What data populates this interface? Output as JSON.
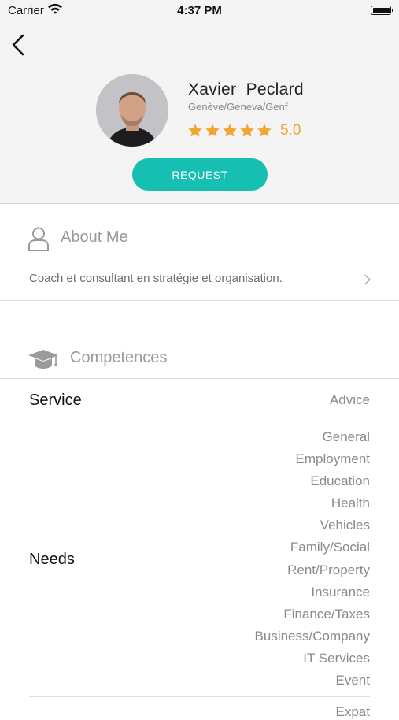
{
  "status_bar": {
    "carrier": "Carrier",
    "time": "4:37 PM"
  },
  "profile": {
    "name": "Xavier  Peclard",
    "location": "Genève/Geneva/Genf",
    "rating_value": "5.0",
    "rating": 5,
    "stars_max": 5,
    "request_label": "REQUEST"
  },
  "about": {
    "title": "About Me",
    "text": "Coach et consultant en stratégie et organisation."
  },
  "competences": {
    "title": "Competences",
    "service_label": "Service",
    "service_value": "Advice",
    "needs_label": "Needs",
    "needs": [
      "General",
      "Employment",
      "Education",
      "Health",
      "Vehicles",
      "Family/Social",
      "Rent/Property",
      "Insurance",
      "Finance/Taxes",
      "Business/Company",
      "IT Services",
      "Event"
    ],
    "partially_visible_item": "Expat"
  },
  "colors": {
    "accent": "#17bfb2",
    "star": "#f2a531"
  }
}
